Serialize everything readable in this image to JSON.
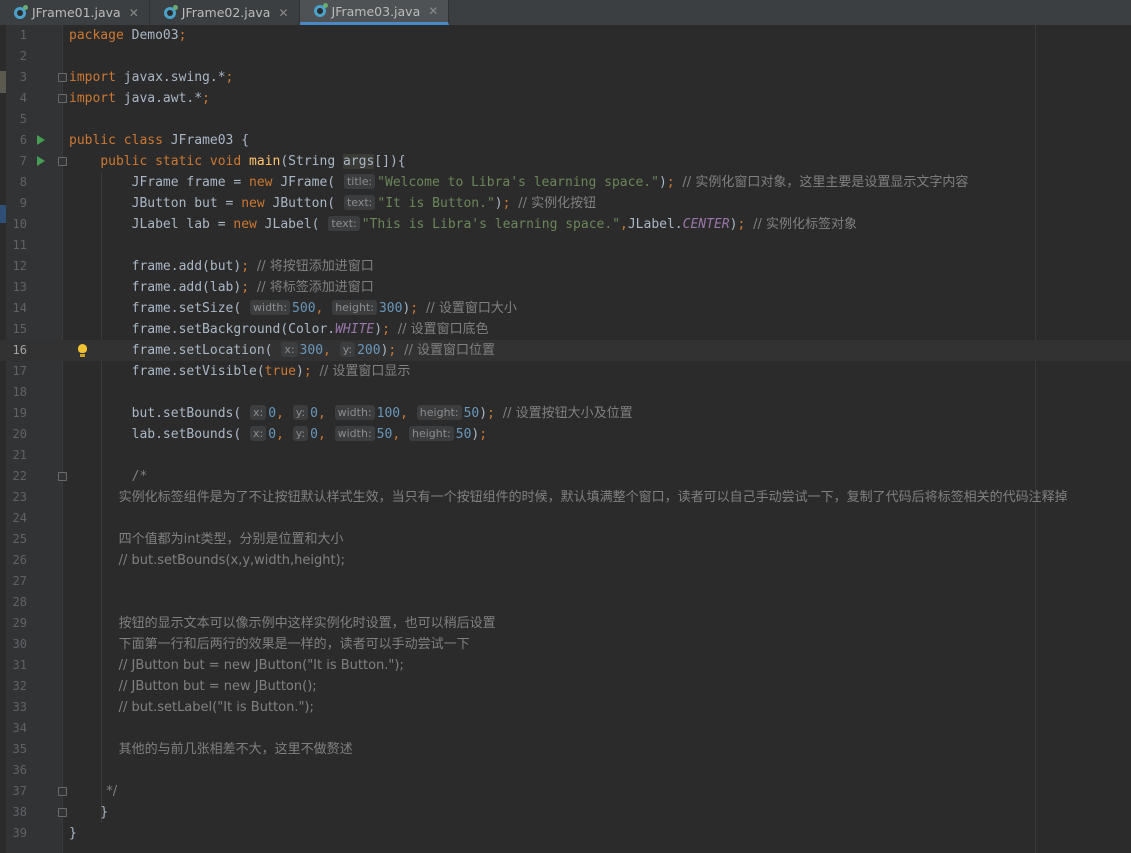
{
  "tabs": [
    {
      "label": "JFrame01.java",
      "active": false
    },
    {
      "label": "JFrame02.java",
      "active": false
    },
    {
      "label": "JFrame03.java",
      "active": true
    }
  ],
  "icons": {
    "file": "java-class-icon",
    "close": "close-icon",
    "run": "run-gutter-icon",
    "fold": "fold-marker-icon",
    "intention": "lightbulb-icon"
  },
  "editor": {
    "current_line": 16,
    "lines": [
      {
        "n": "1",
        "t": "package Demo03;"
      },
      {
        "n": "2",
        "t": ""
      },
      {
        "n": "3",
        "t": "import javax.swing.*;"
      },
      {
        "n": "4",
        "t": "import java.awt.*;"
      },
      {
        "n": "5",
        "t": ""
      },
      {
        "n": "6",
        "t": "public class JFrame03 {"
      },
      {
        "n": "7",
        "t": "    public static void main(String args[]){"
      },
      {
        "n": "8",
        "t": "        JFrame frame = new JFrame( title: \"Welcome to Libra's learning space.\"); // 实例化窗口对象，这里主要是设置显示文字内容"
      },
      {
        "n": "9",
        "t": "        JButton but = new JButton( text: \"It is Button.\"); // 实例化按钮"
      },
      {
        "n": "10",
        "t": "        JLabel lab = new JLabel( text: \"This is Libra's learning space.\",JLabel.CENTER); // 实例化标签对象"
      },
      {
        "n": "11",
        "t": ""
      },
      {
        "n": "12",
        "t": "        frame.add(but); // 将按钮添加进窗口"
      },
      {
        "n": "13",
        "t": "        frame.add(lab); // 将标签添加进窗口"
      },
      {
        "n": "14",
        "t": "        frame.setSize( width: 500, height: 300); // 设置窗口大小"
      },
      {
        "n": "15",
        "t": "        frame.setBackground(Color.WHITE); // 设置窗口底色"
      },
      {
        "n": "16",
        "t": "        frame.setLocation( x: 300, y: 200); // 设置窗口位置"
      },
      {
        "n": "17",
        "t": "        frame.setVisible(true); // 设置窗口显示"
      },
      {
        "n": "18",
        "t": ""
      },
      {
        "n": "19",
        "t": "        but.setBounds( x: 0, y: 0, width: 100, height: 50); // 设置按钮大小及位置"
      },
      {
        "n": "20",
        "t": "        lab.setBounds( x: 0, y: 0, width: 50, height: 50);"
      },
      {
        "n": "21",
        "t": ""
      },
      {
        "n": "22",
        "t": "        /*"
      },
      {
        "n": "23",
        "t": "            实例化标签组件是为了不让按钮默认样式生效，当只有一个按钮组件的时候，默认填满整个窗口，读者可以自己手动尝试一下，复制了代码后将标签相关的代码注释掉"
      },
      {
        "n": "24",
        "t": ""
      },
      {
        "n": "25",
        "t": "            四个值都为int类型，分别是位置和大小"
      },
      {
        "n": "26",
        "t": "            // but.setBounds(x,y,width,height);"
      },
      {
        "n": "27",
        "t": ""
      },
      {
        "n": "28",
        "t": ""
      },
      {
        "n": "29",
        "t": "            按钮的显示文本可以像示例中这样实例化时设置，也可以稍后设置"
      },
      {
        "n": "30",
        "t": "            下面第一行和后两行的效果是一样的，读者可以手动尝试一下"
      },
      {
        "n": "31",
        "t": "            // JButton but = new JButton(\"It is Button.\");"
      },
      {
        "n": "32",
        "t": "            // JButton but = new JButton();"
      },
      {
        "n": "33",
        "t": "            // but.setLabel(\"It is Button.\");"
      },
      {
        "n": "34",
        "t": ""
      },
      {
        "n": "35",
        "t": "            其他的与前几张相差不大，这里不做赘述"
      },
      {
        "n": "36",
        "t": ""
      },
      {
        "n": "37",
        "t": "         */"
      },
      {
        "n": "38",
        "t": "    }"
      },
      {
        "n": "39",
        "t": "}"
      }
    ]
  }
}
